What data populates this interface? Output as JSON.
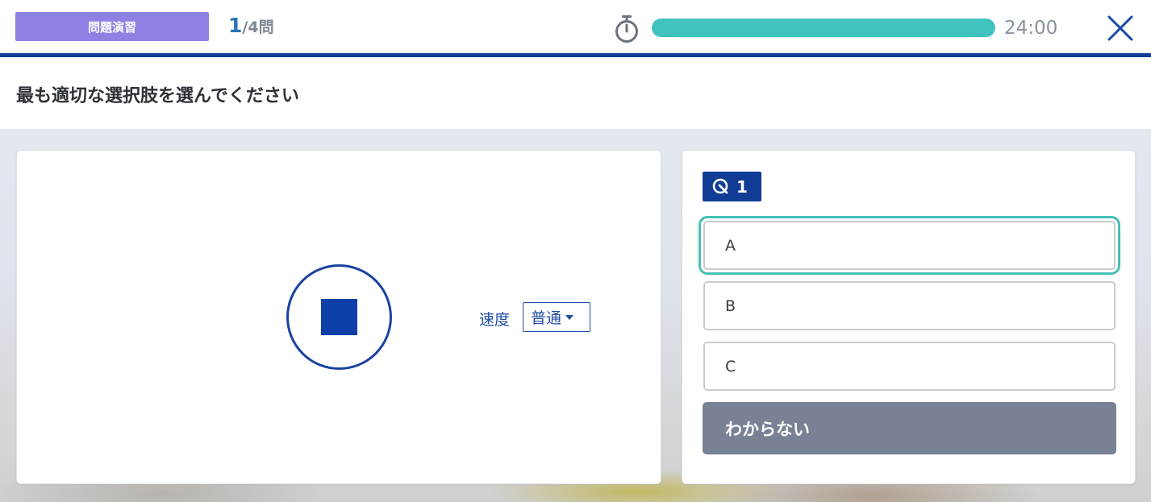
{
  "header": {
    "mode_label": "問題演習",
    "counter_current": "1",
    "counter_total": "/4問",
    "timer_text": "24:00",
    "progress_fraction": 1.0,
    "progress_color": "#40c2bf",
    "accent_color": "#123f94",
    "timer_icon": "stopwatch-icon",
    "close_icon": "close-icon"
  },
  "instruction": {
    "text": "最も適切な選択肢を選んでください"
  },
  "player": {
    "stop_icon": "stop-icon",
    "speed_label": "速度",
    "speed_value": "普通"
  },
  "question": {
    "badge_number": "1",
    "badge_icon": "question-search-icon",
    "options": [
      {
        "label": "A",
        "selected": true
      },
      {
        "label": "B",
        "selected": false
      },
      {
        "label": "C",
        "selected": false
      }
    ],
    "dont_know_label": "わからない"
  }
}
